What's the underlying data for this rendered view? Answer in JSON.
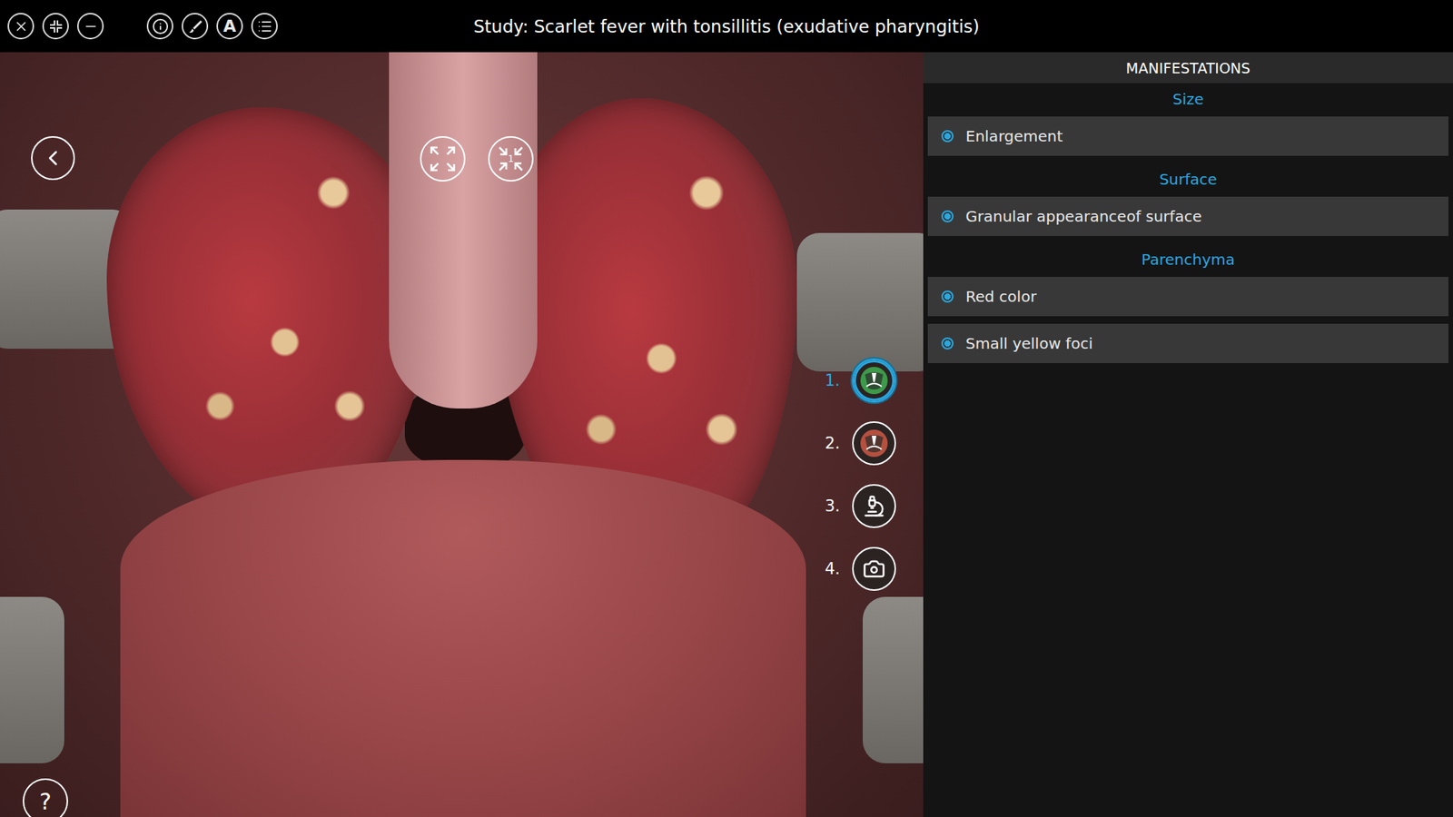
{
  "window": {
    "title": "Study: Scarlet fever with tonsillitis (exudative pharyngitis)"
  },
  "toolbar": {
    "letter_button": "A"
  },
  "viewer": {
    "zoom_badge": "1",
    "help": "?"
  },
  "steps": [
    {
      "label": "1.",
      "selected": true,
      "kind": "throat",
      "color": "#3d9a4a"
    },
    {
      "label": "2.",
      "selected": false,
      "kind": "throat",
      "color": "#b5503f"
    },
    {
      "label": "3.",
      "selected": false,
      "kind": "microscope",
      "color": "#2b2222"
    },
    {
      "label": "4.",
      "selected": false,
      "kind": "camera",
      "color": "#2b2222"
    }
  ],
  "panel": {
    "title": "MANIFESTATIONS",
    "sections": [
      {
        "heading": "Size",
        "items": [
          {
            "label": "Enlargement",
            "marked": true
          }
        ]
      },
      {
        "heading": "Surface",
        "items": [
          {
            "label": "Granular appearanceof surface",
            "marked": true
          }
        ]
      },
      {
        "heading": "Parenchyma",
        "items": [
          {
            "label": "Red color",
            "marked": true
          },
          {
            "label": "Small yellow foci",
            "marked": true
          }
        ]
      }
    ]
  }
}
